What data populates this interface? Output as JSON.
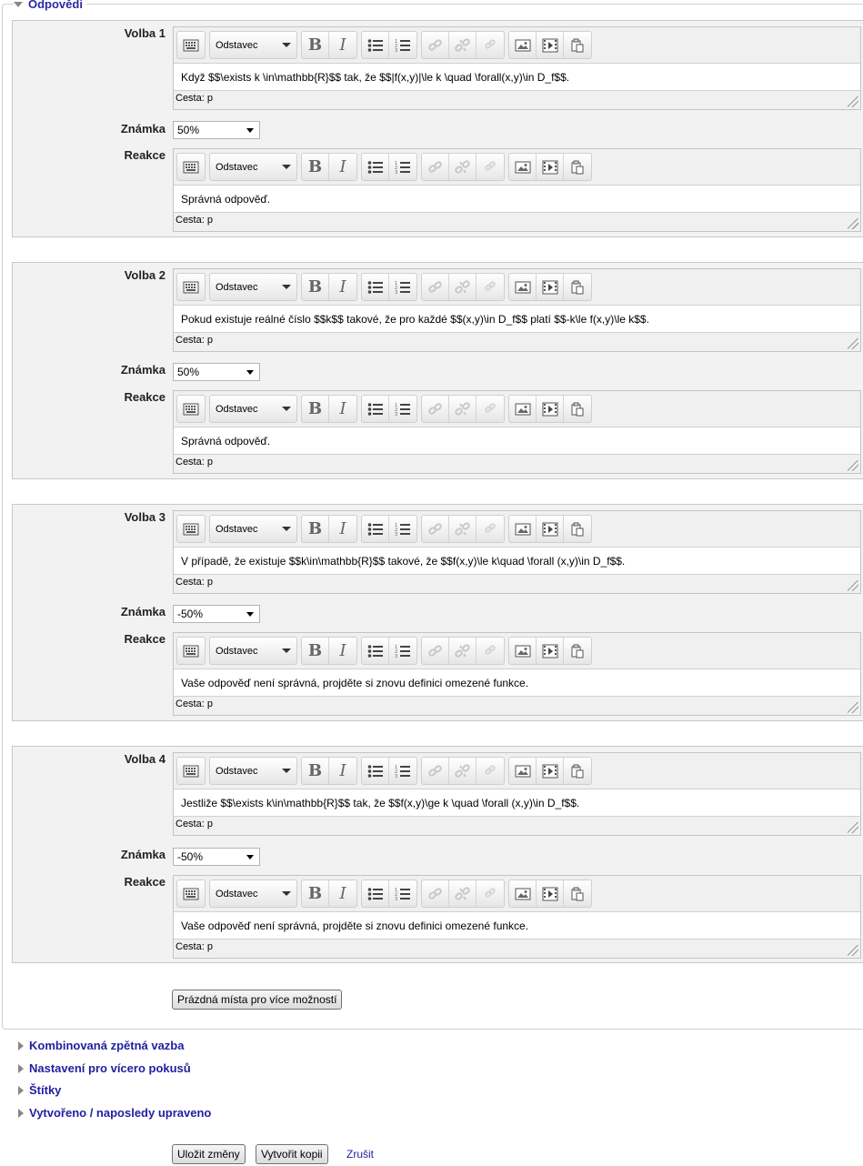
{
  "legend": {
    "title": "Odpovědi"
  },
  "editor_toolbar": {
    "format_value": "Odstavec",
    "icons": [
      "toolbar-toggle-icon",
      "bold-icon",
      "italic-icon",
      "unordered-list-icon",
      "ordered-list-icon",
      "link-icon",
      "unlink-icon",
      "anchor-icon",
      "image-icon",
      "media-icon",
      "paste-icon"
    ]
  },
  "labels": {
    "choice_1": "Volba 1",
    "choice_2": "Volba 2",
    "choice_3": "Volba 3",
    "choice_4": "Volba 4",
    "grade": "Známka",
    "feedback": "Reakce",
    "path": "Cesta: p"
  },
  "choices": [
    {
      "answer": "Když $$\\exists k \\in\\mathbb{R}$$ tak, že $$|f(x,y)|\\le k \\quad \\forall(x,y)\\in D_f$$.",
      "grade": "50%",
      "feedback": "Správná odpověď."
    },
    {
      "answer": "Pokud existuje reálné číslo $$k$$ takové, že pro každé $$(x,y)\\in D_f$$ platí $$-k\\le f(x,y)\\le k$$.",
      "grade": "50%",
      "feedback": "Správná odpověď."
    },
    {
      "answer": "V případě, že existuje $$k\\in\\mathbb{R}$$ takové, že $$f(x,y)\\le k\\quad \\forall (x,y)\\in D_f$$.",
      "grade": "-50%",
      "feedback": "Vaše odpověď není správná, projděte si znovu definici omezené funkce."
    },
    {
      "answer": "Jestliže $$\\exists k\\in\\mathbb{R}$$ tak, že $$f(x,y)\\ge k \\quad \\forall (x,y)\\in D_f$$.",
      "grade": "-50%",
      "feedback": "Vaše odpověď není správná, projděte si znovu definici omezené funkce."
    }
  ],
  "add_blanks_button": "Prázdná místa pro více možností",
  "sections": [
    "Kombinovaná zpětná vazba",
    "Nastavení pro vícero pokusů",
    "Štítky",
    "Vytvořeno / naposledy upraveno"
  ],
  "actions": {
    "save": "Uložit změny",
    "save_copy": "Vytvořit kopii",
    "cancel": "Zrušit"
  },
  "colors": {
    "link": "#1f1fa0",
    "panel_bg": "#f2f2f2"
  }
}
